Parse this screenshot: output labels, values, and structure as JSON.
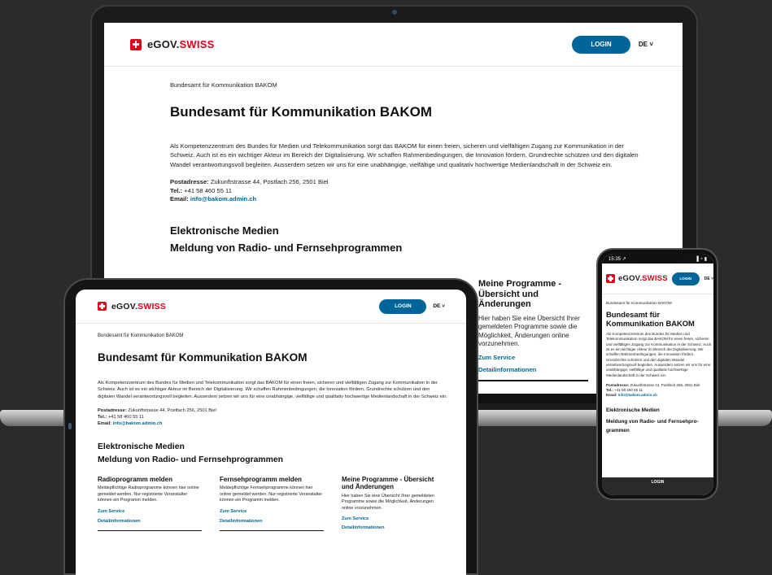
{
  "brand": {
    "prefix": "eGOV.",
    "name": "SWISS"
  },
  "header": {
    "login_label": "LOGIN",
    "lang_label": "DE ˅"
  },
  "breadcrumb": "Bundesamt für Kommunikation BAKOM",
  "title": "Bundesamt für Kommunikation BAKOM",
  "intro": "Als Kompetenzzentrum des Bundes für Medien und Telekommunikation sorgt das BAKOM für einen freien, sicheren und vielfältigen Zugang zur Kommunikation in der Schweiz. Auch ist es ein wichtiger Akteur im Bereich der Digitalisierung. Wir schaffen Rahmenbedingungen, die Innovation fördern, Grundrechte schützen und den digitalen Wandel verantwortungsvoll begleiten. Ausserdem setzen wir uns für eine unabhängige, vielfältige und qualitativ hochwertige Medienlandschaft in der Schweiz ein.",
  "address": {
    "postal_label": "Postadresse:",
    "postal_value": " Zukunftstrasse 44, Postfach 256, 2501 Biel",
    "tel_label": "Tel.:",
    "tel_value": " +41 58 460 55 11",
    "email_label": "Email:",
    "email_value": "info@bakom.admin.ch"
  },
  "section": {
    "heading": "Elektronische Medien",
    "subheading": "Meldung von Radio- und Fernsehprogrammen"
  },
  "services": [
    {
      "title": "Radioprogramm melden",
      "text": "Meldepflichtige Radioprogramme können hier online gemeldet werden. Nur registrierte Veranstalter können ein Programm melden.",
      "link1": "Zum Service",
      "link2": "Detailinformationen"
    },
    {
      "title": "Fernsehprogramm melden",
      "text": "Meldepflichtige Fernsehprogramme können hier online gemeldet werden. Nur registrierte Veranstalter können ein Programm melden.",
      "link1": "Zum Service",
      "link2": "Detailinformationen"
    },
    {
      "title": "Meine Programme - Übersicht und Änderungen",
      "text": "Hier haben Sie eine Übersicht Ihrer gemeldeten Programme sowie die Möglichkeit, Änderungen online vorzunehmen.",
      "link1": "Zum Service",
      "link2": "Detailinformationen"
    }
  ],
  "phone": {
    "section_sub": "Meldung von Radio- und Fernsehpro-\ngrammen",
    "status_time": "15:35 ↗",
    "status_icons": "▐ ◔ ▮",
    "bottom_button": "LOGIN"
  },
  "colors": {
    "accent": "#006699",
    "brand_red": "#e2001a",
    "background": "#2b2b2b"
  }
}
